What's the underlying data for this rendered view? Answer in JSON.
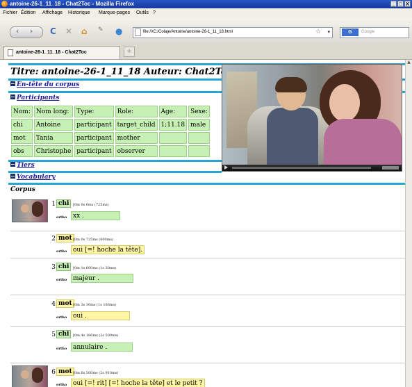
{
  "window": {
    "title": "antoine-26-1_11_18 - Chat2Toc - Mozilla Firefox",
    "buttons": [
      "_",
      "□",
      "X"
    ]
  },
  "menu": [
    "Fichier",
    "Édition",
    "Affichage",
    "Historique",
    "Marque-pages",
    "Outils",
    "?"
  ],
  "navbar": {
    "url": "file:///C:/Colaje/Antoine/antoine-26-1_11_18.html",
    "search_placeholder": "Google",
    "search_engine": "G"
  },
  "tab": {
    "label": "antoine-26-1_11_18 - Chat2Toc",
    "newtab": "+"
  },
  "page": {
    "title": "Titre: antoine-26-1_11_18 Auteur: Chat2Toc",
    "header_link": "En-tête du corpus",
    "participants_link": "Participants",
    "tiers_link": "Tiers",
    "vocabulary_link": "Vocabulary",
    "corpus_label": "Corpus"
  },
  "participants": {
    "headers": [
      "Nom:",
      "Nom long:",
      "Type:",
      "Role:",
      "Age:",
      "Sexe:"
    ],
    "rows": [
      [
        "chi",
        "Antoine",
        "participant",
        "target_child",
        "1;11.18",
        "male"
      ],
      [
        "mot",
        "Tania",
        "participant",
        "mother",
        "",
        ""
      ],
      [
        "obs",
        "Christophe",
        "participant",
        "observer",
        "",
        ""
      ]
    ]
  },
  "utterances": [
    {
      "num": "1",
      "speaker": "chi",
      "time": "[0m 0s 0ms (725ms)",
      "tier": "ortho",
      "text": "xx ."
    },
    {
      "num": "2",
      "speaker": "mot",
      "time": "[0m 0s 725ms (600ms)",
      "tier": "ortho",
      "text": "oui [=! hoche la tête]."
    },
    {
      "num": "3",
      "speaker": "chi",
      "time": "[0m 1s 600ms (1s 30ms)",
      "tier": "ortho",
      "text": "majeur ."
    },
    {
      "num": "4",
      "speaker": "mot",
      "time": "[0m 3s 30ms (1s 186ms)",
      "tier": "ortho",
      "text": "oui ."
    },
    {
      "num": "5",
      "speaker": "chi",
      "time": "[0m 4s 186ms (2s 500ms)",
      "tier": "ortho",
      "text": "annulaire ."
    },
    {
      "num": "6",
      "speaker": "mot",
      "time": "[0m 6s 500ms (2s 910ms)",
      "tier": "ortho",
      "text": "oui [=! rit] [=! hoche la tête] et le petit ?"
    }
  ],
  "colors": {
    "accent_bar": "#25a6d6",
    "chi_green": "#c6f0b4",
    "mot_yellow": "#fff6a6",
    "link_blue": "#1a1a9c"
  },
  "icons": [
    "firefox-icon",
    "back-arrow-icon",
    "forward-arrow-icon",
    "reload-icon",
    "stop-icon",
    "home-icon",
    "bookmark-icon",
    "page-icon",
    "star-icon",
    "play-icon"
  ]
}
